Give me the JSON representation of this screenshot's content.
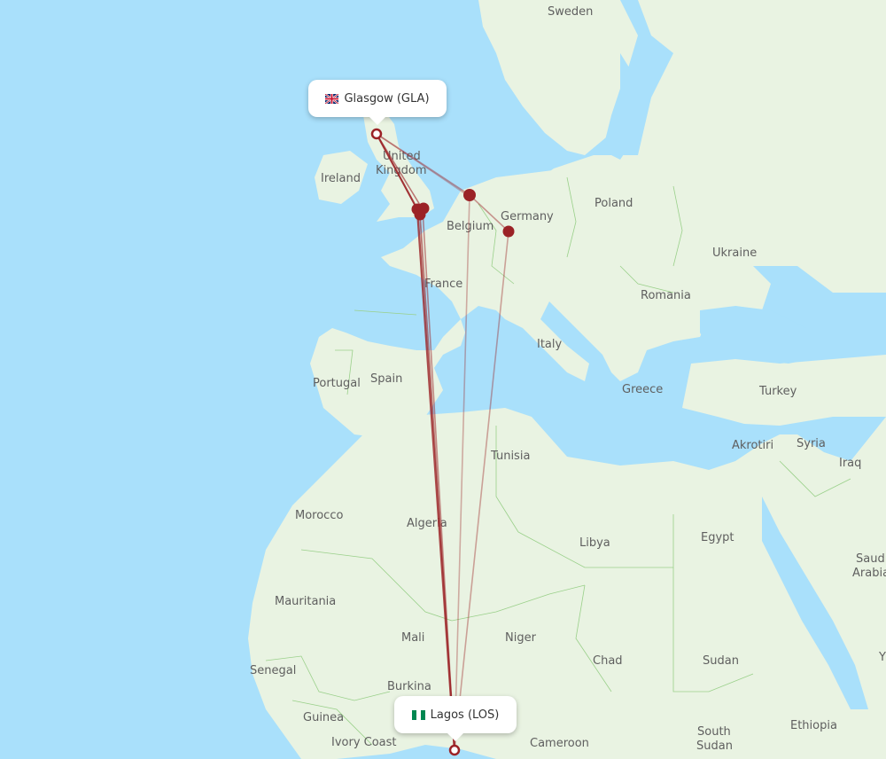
{
  "map": {
    "colors": {
      "water": "#a9e0fb",
      "land": "#e9f3e2",
      "land_highlight": "#dfeed5",
      "border": "#9ad08a",
      "route": "#9b2226",
      "route_light": "#c98a8a",
      "airport_marker": "#9b2226"
    },
    "origin": {
      "city": "Glasgow",
      "code": "GLA",
      "label": "Glasgow (GLA)",
      "flag": "uk-flag-icon"
    },
    "destination": {
      "city": "Lagos",
      "code": "LOS",
      "label": "Lagos (LOS)",
      "flag": "nigeria-flag-icon"
    },
    "stopover_markers": [
      "London cluster",
      "Amsterdam",
      "Frankfurt"
    ],
    "country_labels": [
      {
        "name": "Sweden"
      },
      {
        "name": "United"
      },
      {
        "name": "Kingdom"
      },
      {
        "name": "Ireland"
      },
      {
        "name": "Poland"
      },
      {
        "name": "Germany"
      },
      {
        "name": "Belgium"
      },
      {
        "name": "Ukraine"
      },
      {
        "name": "France"
      },
      {
        "name": "Romania"
      },
      {
        "name": "Italy"
      },
      {
        "name": "Portugal"
      },
      {
        "name": "Spain"
      },
      {
        "name": "Greece"
      },
      {
        "name": "Turkey"
      },
      {
        "name": "Tunisia"
      },
      {
        "name": "Akrotiri"
      },
      {
        "name": "Syria"
      },
      {
        "name": "Iraq"
      },
      {
        "name": "Morocco"
      },
      {
        "name": "Algeria"
      },
      {
        "name": "Libya"
      },
      {
        "name": "Egypt"
      },
      {
        "name": "Saudi"
      },
      {
        "name": "Arabia"
      },
      {
        "name": "Mauritania"
      },
      {
        "name": "Mali"
      },
      {
        "name": "Niger"
      },
      {
        "name": "Chad"
      },
      {
        "name": "Sudan"
      },
      {
        "name": "Senegal"
      },
      {
        "name": "Burkina"
      },
      {
        "name": "Guinea"
      },
      {
        "name": "Ivory Coast"
      },
      {
        "name": "Cameroon"
      },
      {
        "name": "South"
      },
      {
        "name": "Sudan"
      },
      {
        "name": "Ethiopia"
      },
      {
        "name": "Y"
      }
    ]
  }
}
